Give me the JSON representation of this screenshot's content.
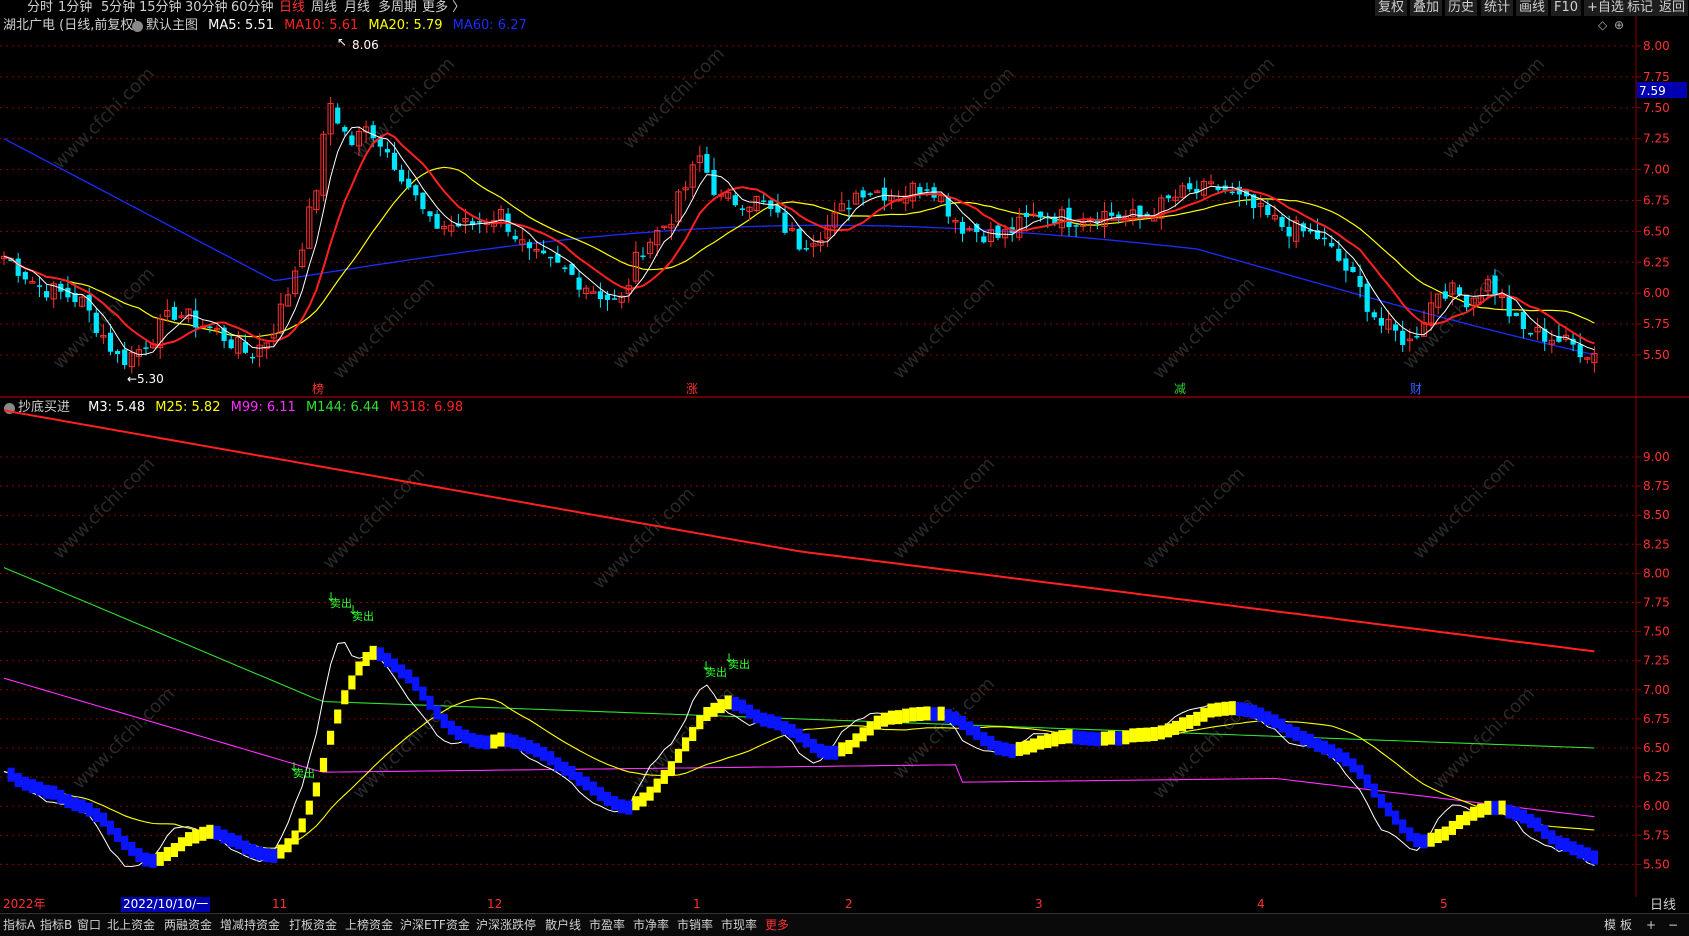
{
  "top_tabs": [
    "分时",
    "1分钟",
    "5分钟",
    "15分钟",
    "30分钟",
    "60分钟",
    "日线",
    "周线",
    "月线",
    "多周期",
    "更多 〉"
  ],
  "active_tab": "日线",
  "right_buttons": [
    "复权",
    "叠加",
    "历史",
    "统计",
    "画线",
    "F10",
    "+自选",
    "标记",
    "返回"
  ],
  "main_chart": {
    "stock_title": "湖北广电 (日线,前复权)",
    "template": "默认主图",
    "ma": [
      {
        "label": "MA5: 5.51",
        "color": "#ffffff"
      },
      {
        "label": "MA10: 5.61",
        "color": "#ff2020"
      },
      {
        "label": "MA20: 5.79",
        "color": "#ffff00"
      },
      {
        "label": "MA60: 6.27",
        "color": "#1c2cff"
      }
    ],
    "high_label": "8.06",
    "low_label": "←5.30",
    "price_tag": "7.59",
    "y_ticks": [
      "8.00",
      "7.75",
      "7.50",
      "7.25",
      "7.00",
      "6.75",
      "6.50",
      "6.25",
      "6.00",
      "5.75",
      "5.50"
    ],
    "markers": [
      {
        "text": "榜",
        "color": "#ff3030"
      },
      {
        "text": "涨",
        "color": "#ff3030"
      },
      {
        "text": "减",
        "color": "#30d030"
      },
      {
        "text": "财",
        "color": "#3060ff"
      }
    ]
  },
  "sub_chart": {
    "title": "抄底买进",
    "legend": [
      {
        "label": "M3: 5.48",
        "color": "#ffffff"
      },
      {
        "label": "M25: 5.82",
        "color": "#ffff00"
      },
      {
        "label": "M99: 6.11",
        "color": "#ff30ff"
      },
      {
        "label": "M144: 6.44",
        "color": "#30e030"
      },
      {
        "label": "M318: 6.98",
        "color": "#ff2020"
      }
    ],
    "y_ticks": [
      "9.00",
      "8.75",
      "8.50",
      "8.25",
      "8.00",
      "7.75",
      "7.50",
      "7.25",
      "7.00",
      "6.75",
      "6.50",
      "6.25",
      "6.00",
      "5.75",
      "5.50"
    ],
    "signal_text": "卖出"
  },
  "date_axis": {
    "labels": [
      "2022年",
      "2022/10/10/一",
      "11",
      "12",
      "1",
      "2",
      "3",
      "4",
      "5"
    ],
    "period": "日线"
  },
  "bottom_tabs": [
    "指标A",
    "指标B",
    "窗口",
    "北上资金",
    "两融资金",
    "增减持资金",
    "打板资金",
    "上榜资金",
    "沪深ETF资金",
    "沪深涨跌停",
    "散户线",
    "市盈率",
    "市净率",
    "市销率",
    "市现率",
    "更多"
  ],
  "bottom_right": [
    "模",
    "板",
    "+",
    "−"
  ],
  "watermark": "www.cfchi.com",
  "colors": {
    "up": "#ff3030",
    "down": "#00e5ff",
    "ma10": "#ff2020",
    "ma20": "#ffff00",
    "ma60": "#1c2cff",
    "grid": "#8a0000"
  }
}
